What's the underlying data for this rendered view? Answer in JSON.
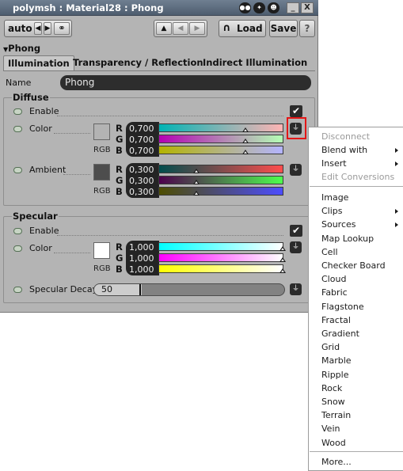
{
  "window": {
    "title": "polymsh : Material28 : Phong",
    "minimize_label": "_",
    "close_label": "X"
  },
  "toolbar": {
    "auto_label": "auto",
    "load_label": "Load",
    "save_label": "Save",
    "help_label": "?"
  },
  "section": {
    "name": "Phong"
  },
  "tabs": [
    "Illumination",
    "Transparency / Reflection",
    "Indirect Illumination"
  ],
  "name_field": {
    "label": "Name",
    "value": "Phong"
  },
  "diffuse": {
    "title": "Diffuse",
    "enable_label": "Enable",
    "enable_checked": true,
    "color": {
      "label": "Color",
      "mode_label": "RGB",
      "swatch_color": "#b3b3b3",
      "channels": [
        {
          "name": "R",
          "value": "0,700",
          "level": 0.7
        },
        {
          "name": "G",
          "value": "0,700",
          "level": 0.7
        },
        {
          "name": "B",
          "value": "0,700",
          "level": 0.7
        }
      ]
    },
    "ambient": {
      "label": "Ambient",
      "mode_label": "RGB",
      "swatch_color": "#4d4d4d",
      "channels": [
        {
          "name": "R",
          "value": "0,300",
          "level": 0.3
        },
        {
          "name": "G",
          "value": "0,300",
          "level": 0.3
        },
        {
          "name": "B",
          "value": "0,300",
          "level": 0.3
        }
      ]
    }
  },
  "specular": {
    "title": "Specular",
    "enable_label": "Enable",
    "enable_checked": true,
    "color": {
      "label": "Color",
      "mode_label": "RGB",
      "swatch_color": "#ffffff",
      "channels": [
        {
          "name": "R",
          "value": "1,000",
          "level": 1.0
        },
        {
          "name": "G",
          "value": "1,000",
          "level": 1.0
        },
        {
          "name": "B",
          "value": "1,000",
          "level": 1.0
        }
      ]
    },
    "decay": {
      "label": "Specular Decay",
      "value": "50",
      "level": 0.25
    }
  },
  "icons": {
    "connect": "plug-icon",
    "checkbox": "checkmark-icon"
  },
  "colors": {
    "highlight": "#e31616",
    "titlebar": "#5a697b"
  },
  "context_menu": {
    "top_items": [
      {
        "label": "Disconnect",
        "disabled": true,
        "submenu": false
      },
      {
        "label": "Blend with",
        "disabled": false,
        "submenu": true
      },
      {
        "label": "Insert",
        "disabled": false,
        "submenu": true
      },
      {
        "label": "Edit Conversions",
        "disabled": true,
        "submenu": false
      }
    ],
    "items": [
      {
        "label": "Image",
        "submenu": false
      },
      {
        "label": "Clips",
        "submenu": true
      },
      {
        "label": "Sources",
        "submenu": true
      },
      {
        "label": "Map Lookup",
        "submenu": false
      },
      {
        "label": "Cell",
        "submenu": false
      },
      {
        "label": "Checker Board",
        "submenu": false
      },
      {
        "label": "Cloud",
        "submenu": false
      },
      {
        "label": "Fabric",
        "submenu": false
      },
      {
        "label": "Flagstone",
        "submenu": false
      },
      {
        "label": "Fractal",
        "submenu": false
      },
      {
        "label": "Gradient",
        "submenu": false
      },
      {
        "label": "Grid",
        "submenu": false
      },
      {
        "label": "Marble",
        "submenu": false
      },
      {
        "label": "Ripple",
        "submenu": false
      },
      {
        "label": "Rock",
        "submenu": false
      },
      {
        "label": "Snow",
        "submenu": false
      },
      {
        "label": "Terrain",
        "submenu": false
      },
      {
        "label": "Vein",
        "submenu": false
      },
      {
        "label": "Wood",
        "submenu": false
      }
    ],
    "more_label": "More..."
  }
}
